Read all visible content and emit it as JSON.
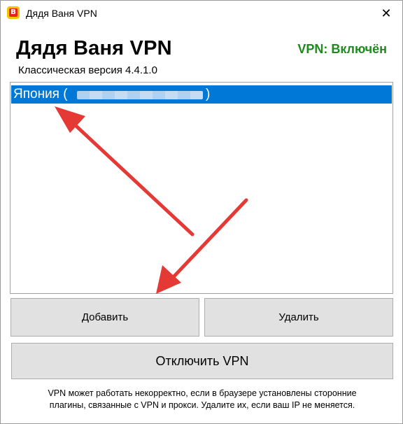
{
  "window": {
    "title": "Дядя Ваня VPN",
    "close_glyph": "✕",
    "app_icon_letter": "В"
  },
  "header": {
    "app_name": "Дядя Ваня VPN",
    "version": "Классическая версия 4.4.1.0",
    "status": "VPN: Включён",
    "status_color": "#1e8a1e"
  },
  "server_list": {
    "selected_color": "#0078d7",
    "items": [
      {
        "name": "Япония (",
        "close_paren": ")"
      }
    ]
  },
  "buttons": {
    "add": "Добавить",
    "delete": "Удалить",
    "disconnect": "Отключить VPN"
  },
  "footer": {
    "note_line1": "VPN может работать некорректно, если в браузере установлены сторонние",
    "note_line2": "плагины, связанные с VPN и прокси. Удалите их, если ваш IP не меняется."
  },
  "annotations": {
    "arrow_color": "#e53935"
  }
}
